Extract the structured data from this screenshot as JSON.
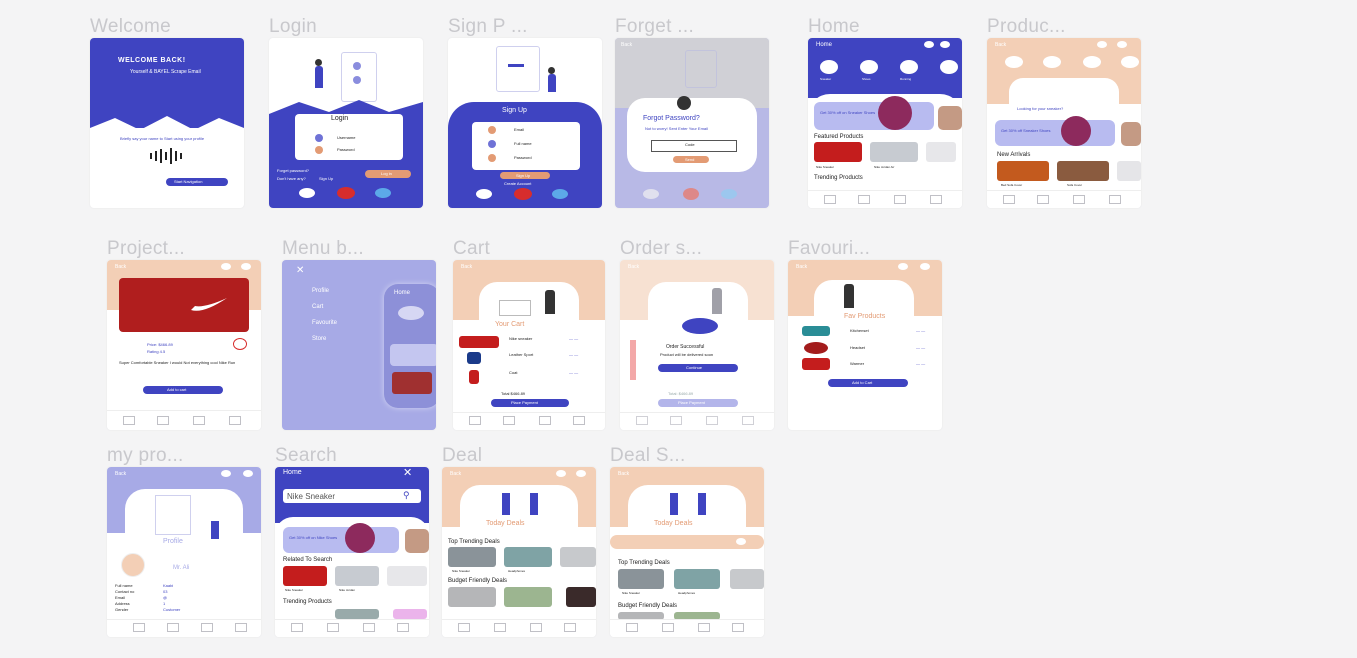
{
  "colors": {
    "primary": "#3f44c1",
    "peach": "#f3cfb6",
    "lavender": "#a7aae6",
    "orange": "#e39b74",
    "red": "#d72d2d",
    "bg": "#f4f4f5"
  },
  "frames": {
    "welcome": {
      "title": "Welcome",
      "welcome_text": "WELCOME BACK!",
      "sub": "Yourself & BAYEL Scrape Email",
      "voice": "Briefly say your name to Start using your profile",
      "button": "Start Navigation"
    },
    "login": {
      "title": "Login",
      "heading": "Login",
      "email": "Username",
      "password": "Password",
      "forgot": "Forget password?",
      "no_account": "Don't have any?",
      "signup": "Sign Up",
      "button": "Log in"
    },
    "signup": {
      "title": "Sign P ...",
      "heading": "Sign Up",
      "email": "Email",
      "name": "Full name",
      "password": "Password",
      "button": "Sign Up",
      "already": "Create Account"
    },
    "forget": {
      "title": "Forget ...",
      "back": "Back",
      "heading": "Forgot Password?",
      "sub": "Not to worry! Sent Enter Your Email",
      "code": "Code",
      "button": "Send"
    },
    "home": {
      "title": "Home",
      "header": "Home",
      "cats": [
        "Sneaker",
        "Shoes",
        "Running",
        "Formal"
      ],
      "banner": "Get 30% off on Sneaker Shoes",
      "featured": "Featured Products",
      "trending": "Trending Products",
      "item1": "Nike Sneaker",
      "item2": "Nike Jordan Air"
    },
    "product": {
      "title": "Produc...",
      "back": "Back",
      "banner": "Get 30% off Sneaker Shoes",
      "new": "New Arrivals",
      "look": "Looking for your sneaker?",
      "item": "Bed Sofa Cover",
      "item2": "Sofa Cover"
    },
    "project": {
      "title": "Project...",
      "back": "Back",
      "price": "Price: $466.89",
      "rating": "Rating 4.5",
      "desc": "Super Comfortable Sneaker I would Not everything cool Nike Run",
      "button": "Add to cart"
    },
    "menu": {
      "title": "Menu b...",
      "items": [
        "Profile",
        "Cart",
        "Favourite",
        "Store"
      ],
      "home": "Home"
    },
    "cart": {
      "title": "Cart",
      "back": "Back",
      "heading": "Your Cart",
      "items": [
        "Nike sneaker",
        "Leather Sport",
        "Coat"
      ],
      "total": "Total $466.89",
      "button": "Place Payment"
    },
    "order": {
      "title": "Order s...",
      "back": "Back",
      "msg": "Order Successful",
      "sub": "Product will be delivered soon",
      "button": "Continue",
      "total": "Total: $466.89",
      "button2": "Place Payment"
    },
    "favourite": {
      "title": "Favouri...",
      "back": "Back",
      "heading": "Fav Products",
      "items": [
        "Kitchenset",
        "Headset",
        "Warmer"
      ],
      "button": "Add to Cart"
    },
    "myprofile": {
      "title": "my pro...",
      "back": "Back",
      "heading": "Profile",
      "name": "Mr. Ali",
      "fields": [
        "Full name",
        "Contact no",
        "Email",
        "Address",
        "Gender"
      ],
      "values": [
        "Kaabi",
        "03",
        "@",
        "1",
        "Customer"
      ]
    },
    "search": {
      "title": "Search",
      "header": "Home",
      "placeholder": "Nike Sneaker",
      "banner": "Get 30% off on Nike Shoes",
      "related": "Related To Search",
      "trending": "Trending Products",
      "item1": "Nike Sneaker",
      "item2": "Nike Jordan"
    },
    "deal": {
      "title": "Deal",
      "back": "Back",
      "heading": "Today Deals",
      "top": "Top Trending Deals",
      "budget": "Budget Friendly Deals",
      "item1": "Nike Sneaker",
      "item2": "Headphones"
    },
    "dealS": {
      "title": "Deal S...",
      "back": "Back",
      "heading": "Today Deals",
      "top": "Top Trending Deals",
      "budget": "Budget Friendly Deals",
      "item1": "Nike Sneaker",
      "item2": "Headphones"
    }
  }
}
